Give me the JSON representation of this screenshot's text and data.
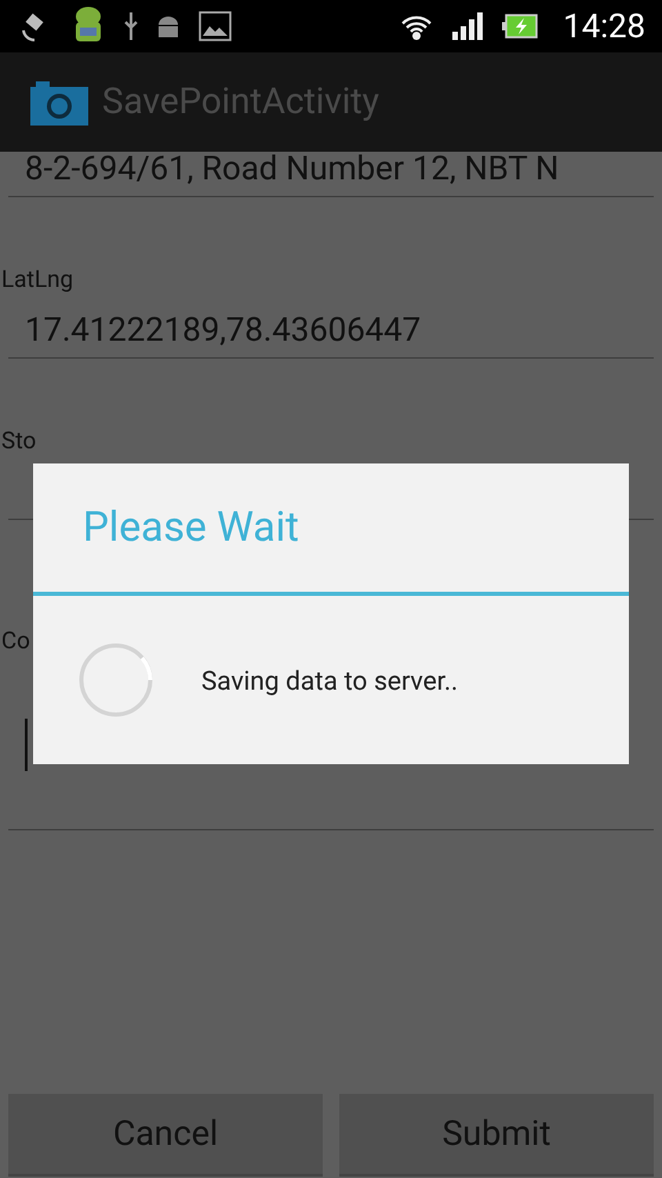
{
  "status_bar": {
    "time": "14:28"
  },
  "action_bar": {
    "title": "SavePointActivity"
  },
  "form": [
    {
      "kind": "partial",
      "value": "8-2-694/61, Road Number 12, NBT N"
    },
    {
      "kind": "field",
      "label": "LatLng",
      "value": "17.41222189,78.43606447"
    },
    {
      "kind": "field",
      "label": "Sto"
    },
    {
      "kind": "multiline",
      "label": "Co",
      "focused": true
    }
  ],
  "buttons": [
    "Cancel",
    "Submit"
  ],
  "dialog": {
    "title": "Please Wait",
    "message": "Saving data to server.."
  }
}
